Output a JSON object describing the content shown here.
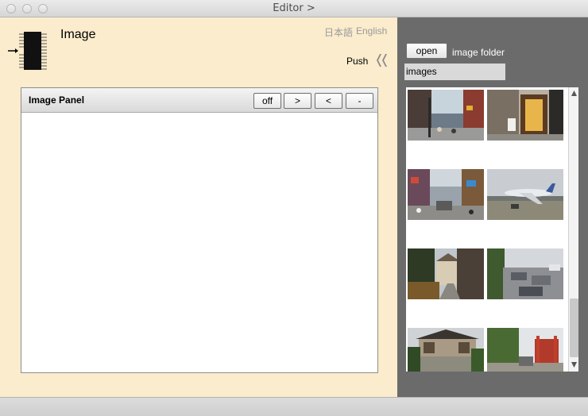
{
  "window": {
    "title": "Editor >"
  },
  "header": {
    "title": "Image",
    "icon": "chip-icon",
    "lang_ja": "日本語",
    "lang_en": "English",
    "push_label": "Push",
    "push_icon": "double-chevron-left-icon"
  },
  "image_panel": {
    "title": "Image Panel",
    "buttons": {
      "off": "off",
      "next": ">",
      "prev": "<",
      "minus": "-"
    }
  },
  "folder": {
    "open_label": "open",
    "label": "image folder",
    "value": "images"
  },
  "thumbnails": [
    {
      "name": "street-scene-1"
    },
    {
      "name": "shop-entrance"
    },
    {
      "name": "street-scene-2"
    },
    {
      "name": "airplane-on-runway"
    },
    {
      "name": "old-building-lane"
    },
    {
      "name": "rooftop-view"
    },
    {
      "name": "temple-gate"
    },
    {
      "name": "shrine-garden"
    }
  ],
  "colors": {
    "left_panel_bg": "#faeccc",
    "right_panel_bg": "#6b6b6b"
  }
}
